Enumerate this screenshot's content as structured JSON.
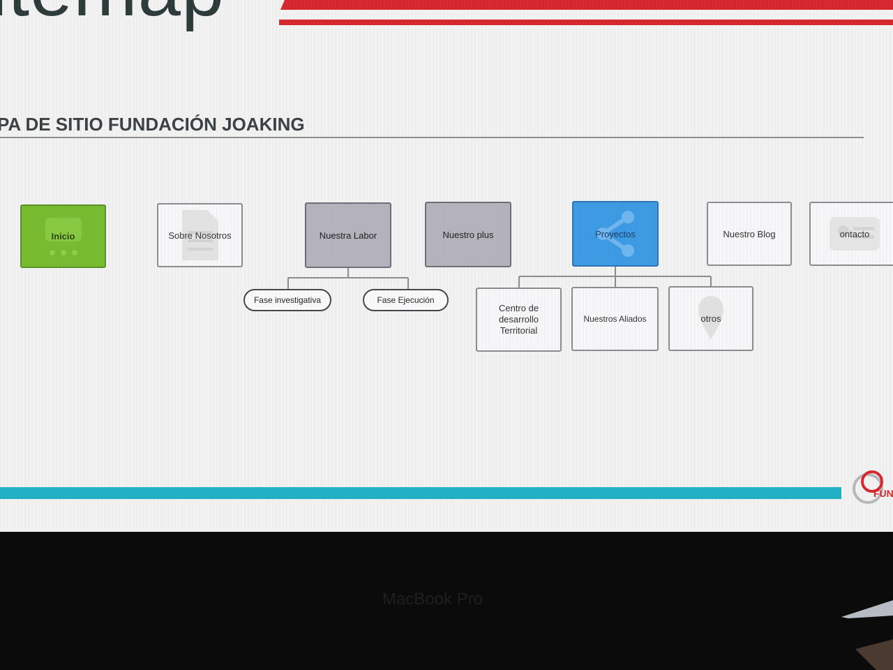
{
  "header": {
    "title": "itemap",
    "subtitle": "PA DE SITIO FUNDACIÓN JOAKING"
  },
  "sitemap": {
    "top": [
      {
        "label": "Inicio"
      },
      {
        "label": "Sobre Nosotros"
      },
      {
        "label": "Nuestra Labor"
      },
      {
        "label": "Nuestro plus"
      },
      {
        "label": "Proyectos"
      },
      {
        "label": "Nuestro Blog"
      },
      {
        "label": "ontacto"
      }
    ],
    "labor_children": [
      {
        "label": "Fase investigativa"
      },
      {
        "label": "Fase Ejecución"
      }
    ],
    "proyectos_children": [
      {
        "label": "Centro de desarrollo Territorial"
      },
      {
        "label": "Nuestros Aliados"
      },
      {
        "label": "otros"
      }
    ]
  },
  "logo": {
    "text": "FUN"
  },
  "device": {
    "label": "MacBook Pro"
  },
  "colors": {
    "inicio": "#76bc2c",
    "labor": "#b4b3bb",
    "proyectos": "#3b9ae1",
    "accent_red": "#d6262b",
    "bar_teal": "#1fb0c2"
  }
}
